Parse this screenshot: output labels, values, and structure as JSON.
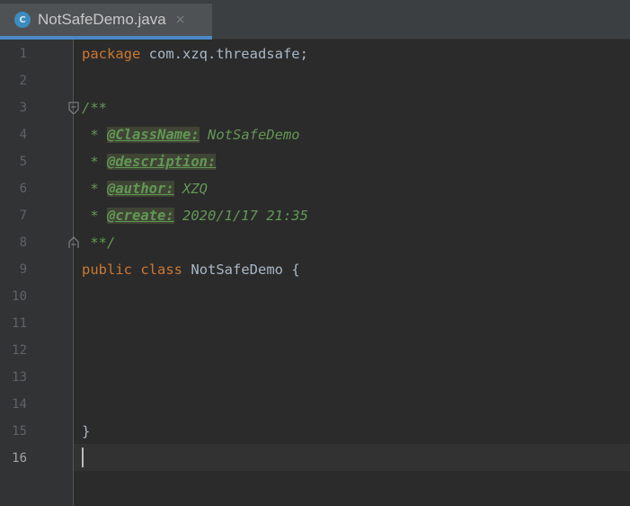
{
  "tab": {
    "icon_letter": "C",
    "title": "NotSafeDemo.java",
    "close_glyph": "×"
  },
  "gutter": {
    "line_numbers": [
      "1",
      "2",
      "3",
      "4",
      "5",
      "6",
      "7",
      "8",
      "9",
      "10",
      "11",
      "12",
      "13",
      "14",
      "15",
      "16"
    ],
    "current_line": "16"
  },
  "code": {
    "line1_kw": "package",
    "line1_rest": " com.xzq.threadsafe;",
    "line3_open": "/**",
    "line4_prefix": " * ",
    "line4_tag": "@ClassName:",
    "line4_value": " NotSafeDemo",
    "line5_prefix": " * ",
    "line5_tag": "@description:",
    "line6_prefix": " * ",
    "line6_tag": "@author:",
    "line6_value": " XZQ",
    "line7_prefix": " * ",
    "line7_tag": "@create:",
    "line7_value": " 2020/1/17 21:35",
    "line8_close": " **/",
    "line9_kw1": "public",
    "line9_kw2": "class",
    "line9_name": "NotSafeDemo",
    "line9_brace": "{",
    "line15_brace": "}"
  },
  "colors": {
    "keyword": "#cc7832",
    "text": "#a9b7c6",
    "doc_comment": "#629755",
    "background": "#2b2b2b",
    "tab_underline": "#4a88c7"
  }
}
